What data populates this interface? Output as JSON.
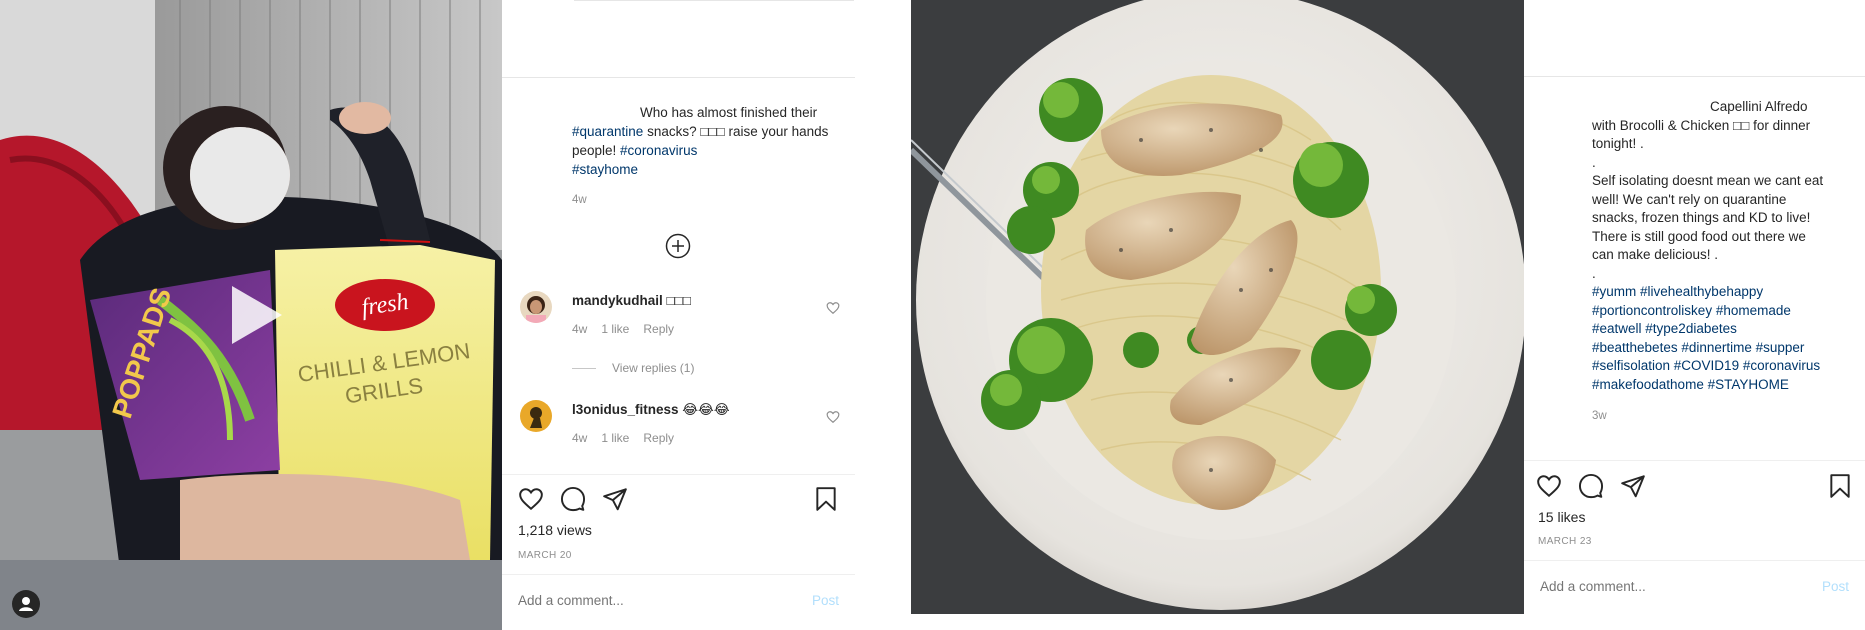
{
  "post1": {
    "caption_prefix": "Who has almost finished their ",
    "tag1": "#quarantine",
    "caption_mid": " snacks? □□□ raise your hands people! ",
    "tag2": "#coronavirus",
    "tag3": "#stayhome",
    "caption_time": "4w",
    "comments": [
      {
        "user": "mandykudhail",
        "text_suffix": " □□□",
        "time": "4w",
        "likes": "1 like",
        "reply": "Reply",
        "view_replies": "View replies (1)"
      },
      {
        "user": "l3onidus_fitness",
        "text_suffix": " 😂😂😂",
        "time": "4w",
        "likes": "1 like",
        "reply": "Reply"
      }
    ],
    "views": "1,218 views",
    "date": "MARCH 20",
    "add_comment_placeholder": "Add a comment...",
    "post_label": "Post",
    "icons": {
      "play": "play-icon",
      "user": "user-icon",
      "heart": "heart-icon",
      "comment": "comment-icon",
      "share": "share-icon",
      "bookmark": "bookmark-icon",
      "add": "plus-circle-icon"
    }
  },
  "post2": {
    "caption_l1": "Capellini Alfredo",
    "caption_l2": "with Brocolli & Chicken □□ for dinner",
    "caption_l3": "tonight! .",
    "caption_l4": ".",
    "caption_l5": "Self isolating doesnt mean we cant eat",
    "caption_l6": "well! We can't rely on quarantine",
    "caption_l7": "snacks, frozen things and KD to live!",
    "caption_l8": "There is still good food out there we",
    "caption_l9": "can make delicious! .",
    "caption_l10": ".",
    "hashtags": [
      "#yumm #livehealthybehappy",
      "#portioncontroliskey #homemade",
      "#eatwell #type2diabetes",
      "#beatthebetes #dinnertime #supper",
      "#selfisolation #COVID19 #coronavirus",
      "#makefoodathome #STAYHOME"
    ],
    "caption_time": "3w",
    "likes": "15 likes",
    "date": "MARCH 23",
    "add_comment_placeholder": "Add a comment...",
    "post_label": "Post"
  },
  "colors": {
    "link": "#00376b",
    "muted": "#8e8e8e",
    "post_button": "#b2dffc",
    "text": "#262626"
  }
}
